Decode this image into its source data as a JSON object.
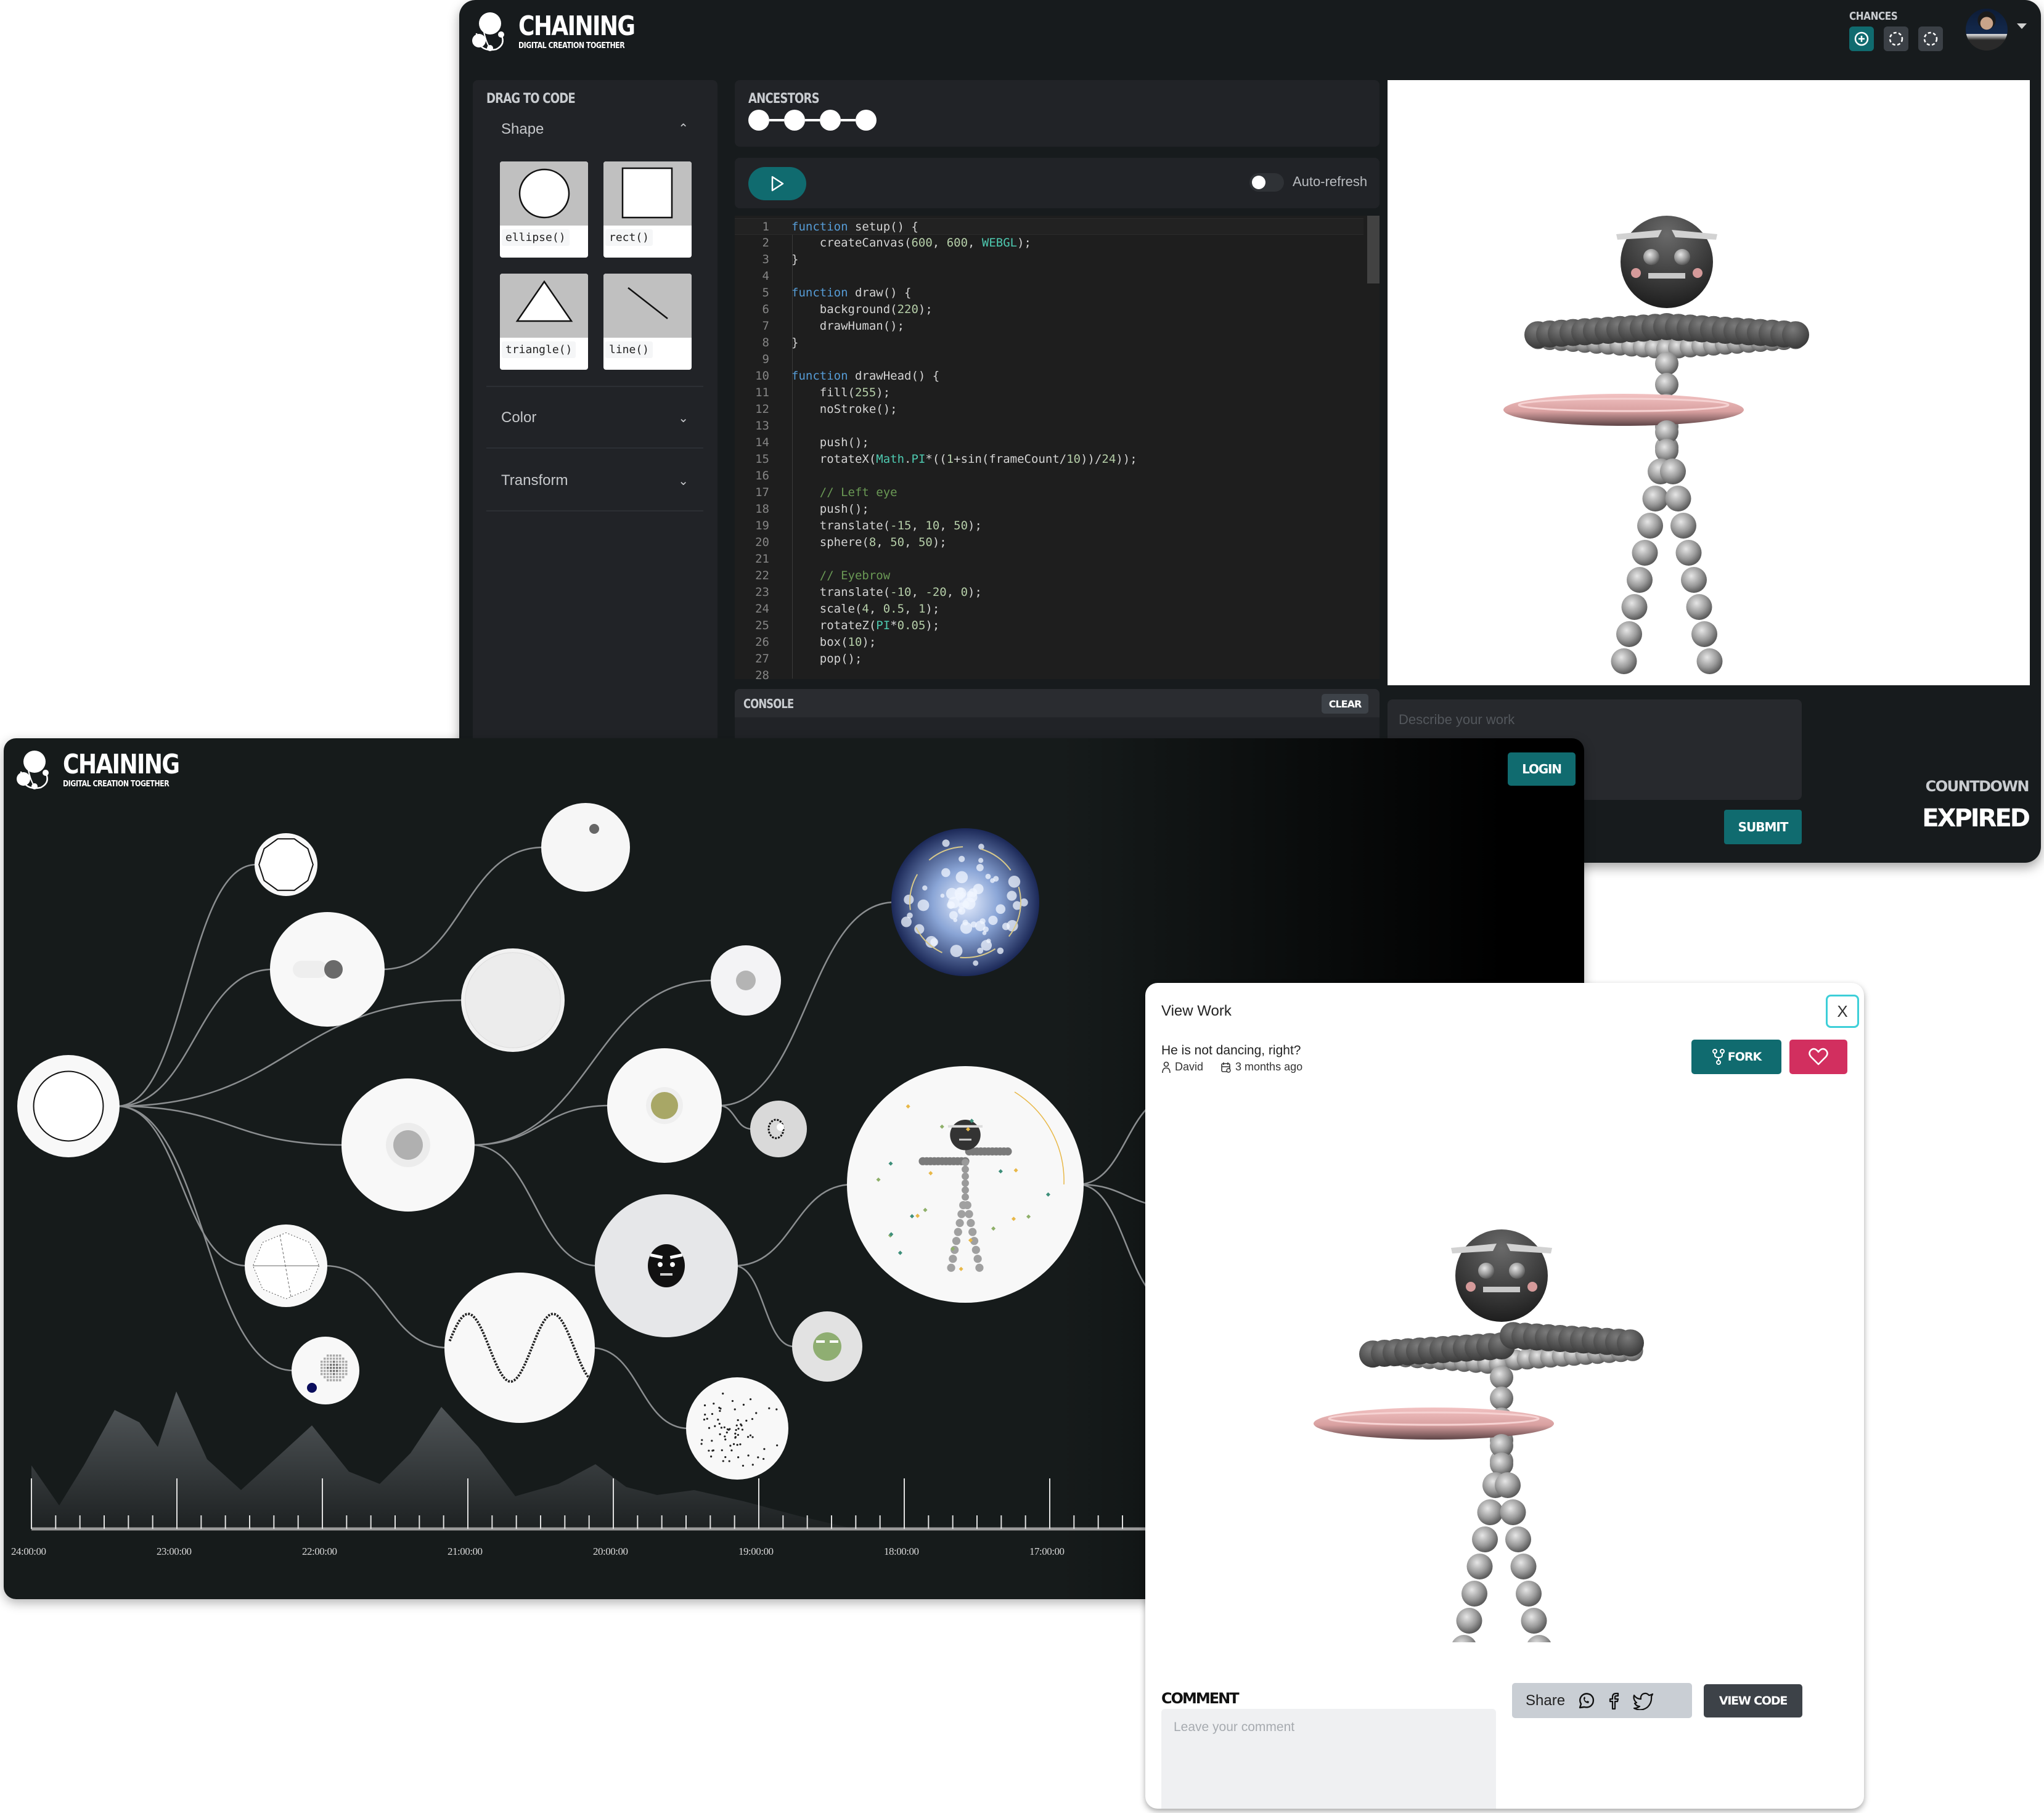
{
  "brand": {
    "name": "CHAINING",
    "tagline": "DIGITAL CREATION TOGETHER"
  },
  "editor": {
    "chances": {
      "label": "CHANCES",
      "items": [
        {
          "state": "available",
          "icon": "plus-circle-icon"
        },
        {
          "state": "used",
          "icon": "dashed-circle-icon"
        },
        {
          "state": "used",
          "icon": "dashed-circle-icon"
        }
      ]
    },
    "user_menu": {
      "avatar": "user-avatar",
      "caret_icon": "caret-down-icon"
    },
    "drag_to_code": {
      "heading": "DRAG TO CODE",
      "sections": [
        {
          "label": "Shape",
          "expanded": true,
          "chevron": "chevron-up-icon"
        },
        {
          "label": "Color",
          "expanded": false,
          "chevron": "chevron-down-icon"
        },
        {
          "label": "Transform",
          "expanded": false,
          "chevron": "chevron-down-icon"
        }
      ],
      "shapes": [
        {
          "name": "ellipse",
          "label": "ellipse()"
        },
        {
          "name": "rect",
          "label": "rect()"
        },
        {
          "name": "triangle",
          "label": "triangle()"
        },
        {
          "name": "line",
          "label": "line()"
        }
      ]
    },
    "ancestors": {
      "heading": "ANCESTORS",
      "count": 4
    },
    "toolbar": {
      "run_icon": "play-icon",
      "auto_refresh_label": "Auto-refresh",
      "auto_refresh_on": false
    },
    "code": {
      "lines": [
        "function setup() {",
        "    createCanvas(600, 600, WEBGL);",
        "}",
        "",
        "function draw() {",
        "    background(220);",
        "    drawHuman();",
        "}",
        "",
        "function drawHead() {",
        "    fill(255);",
        "    noStroke();",
        "",
        "    push();",
        "    rotateX(Math.PI*((1+sin(frameCount/10))/24));",
        "",
        "    // Left eye",
        "    push();",
        "    translate(-15, 10, 50);",
        "    sphere(8, 50, 50);",
        "",
        "    // Eyebrow",
        "    translate(-10, -20, 0);",
        "    scale(4, 0.5, 1);",
        "    rotateZ(PI*0.05);",
        "    box(10);",
        "    pop();",
        ""
      ]
    },
    "console": {
      "heading": "CONSOLE",
      "clear_label": "CLEAR"
    },
    "describe": {
      "placeholder": "Describe your work",
      "value": ""
    },
    "submit_label": "SUBMIT",
    "countdown": {
      "label": "COUNTDOWN",
      "value": "EXPIRED"
    }
  },
  "gallery": {
    "login_label": "LOGIN",
    "timeline": {
      "labels": [
        "24:00:00",
        "23:00:00",
        "22:00:00",
        "21:00:00",
        "20:00:00",
        "19:00:00",
        "18:00:00",
        "17:00:00"
      ]
    }
  },
  "modal": {
    "title": "View Work",
    "close_label": "X",
    "work": {
      "description": "He is not dancing, right?",
      "author": "David",
      "posted": "3 months ago"
    },
    "fork_label": "FORK",
    "like_icon": "heart-icon",
    "comment": {
      "label": "COMMENT",
      "placeholder": "Leave your comment",
      "value": ""
    },
    "share": {
      "label": "Share",
      "icons": [
        "whatsapp-icon",
        "facebook-icon",
        "twitter-icon"
      ]
    },
    "view_code_label": "VIEW CODE"
  },
  "colors": {
    "accent_teal": "#106b6f",
    "like_pink": "#d22f5f",
    "close_outline": "#3dcfd8",
    "editor_bg": "#171b1d",
    "panel_bg": "#212327",
    "hoop_pink": "#e8a9aa"
  }
}
